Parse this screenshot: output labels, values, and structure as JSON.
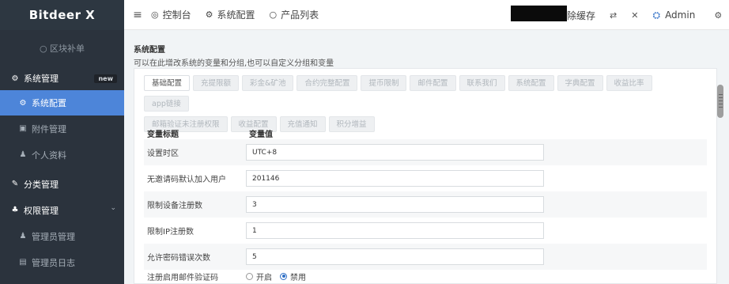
{
  "sidebar": {
    "logo": "Bitdeer X",
    "block_supplement": "○ 区块补单",
    "system_manage": "系统管理",
    "new_badge": "new",
    "system_config": "系统配置",
    "attachment_manage": "附件管理",
    "profile": "个人资料",
    "category_manage": "分类管理",
    "permission_manage": "权限管理",
    "admin_manage": "管理员管理",
    "admin_log": "管理员日志"
  },
  "topbar": {
    "dashboard": "控制台",
    "system_config": "系统配置",
    "product_list": "产品列表",
    "clear_cache": "除缓存",
    "admin": "Admin"
  },
  "header": {
    "title": "系统配置",
    "subtitle": "可以在此增改系统的变量和分组,也可以自定义分组和变量"
  },
  "tabs": {
    "row1": [
      "基础配置",
      "充提限额",
      "彩金&矿池",
      "合约完整配置",
      "提币限制",
      "邮件配置",
      "联系我们",
      "系统配置",
      "字典配置",
      "收益比率",
      "app链接"
    ],
    "row2": [
      "邮箱验证未注册权限",
      "收益配置",
      "充值通知",
      "积分增益"
    ]
  },
  "table": {
    "col_title": "变量标题",
    "col_value": "变量值",
    "rows": [
      {
        "label": "设置时区",
        "value": "UTC+8"
      },
      {
        "label": "无邀请码默认加入用户",
        "value": "201146"
      },
      {
        "label": "限制设备注册数",
        "value": "3"
      },
      {
        "label": "限制IP注册数",
        "value": "1"
      },
      {
        "label": "允许密码错误次数",
        "value": "5"
      }
    ],
    "radio_row": {
      "label": "注册启用邮件验证码",
      "option_on": "开启",
      "option_off": "禁用",
      "selected": "禁用"
    }
  },
  "colors": {
    "sidebar_bg": "#2b333d",
    "active_blue": "#4d85d9",
    "accent": "#2f6fc6"
  }
}
